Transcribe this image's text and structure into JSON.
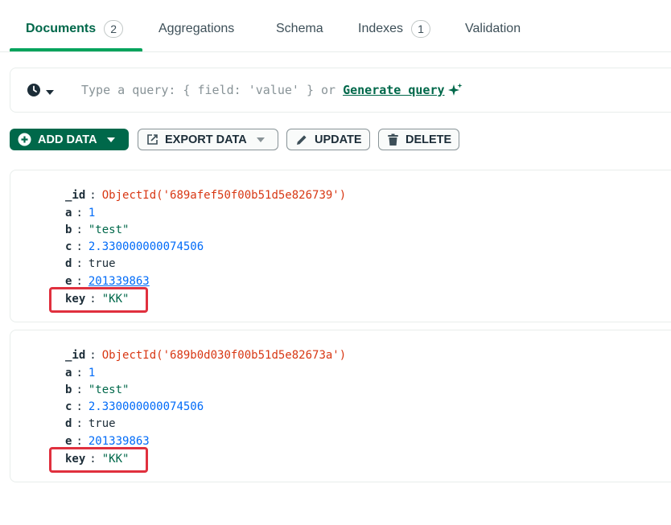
{
  "tabs": [
    {
      "label": "Documents",
      "count": "2"
    },
    {
      "label": "Aggregations"
    },
    {
      "label": "Schema"
    },
    {
      "label": "Indexes",
      "count": "1"
    },
    {
      "label": "Validation"
    }
  ],
  "query": {
    "placeholder": "Type a query: { field: 'value' } or",
    "generate_label": "Generate query"
  },
  "toolbar": {
    "add_data": "ADD DATA",
    "export_data": "EXPORT DATA",
    "update": "UPDATE",
    "delete": "DELETE"
  },
  "documents": [
    {
      "id_key": "_id",
      "id_value": "ObjectId('689afef50f00b51d5e826739')",
      "a": "1",
      "b": "\"test\"",
      "c": "2.330000000074506",
      "d": "true",
      "e": "201339863",
      "key": "\"KK\""
    },
    {
      "id_key": "_id",
      "id_value": "ObjectId('689b0d030f00b51d5e82673a')",
      "a": "1",
      "b": "\"test\"",
      "c": "2.330000000074506",
      "d": "true",
      "e": "201339863",
      "key": "\"KK\""
    }
  ],
  "field_names": {
    "a": "a",
    "b": "b",
    "c": "c",
    "d": "d",
    "e": "e",
    "key": "key"
  },
  "colors": {
    "accent": "#00684a",
    "highlight": "#e0303e",
    "oid": "#d83713",
    "number": "#016bf8"
  }
}
